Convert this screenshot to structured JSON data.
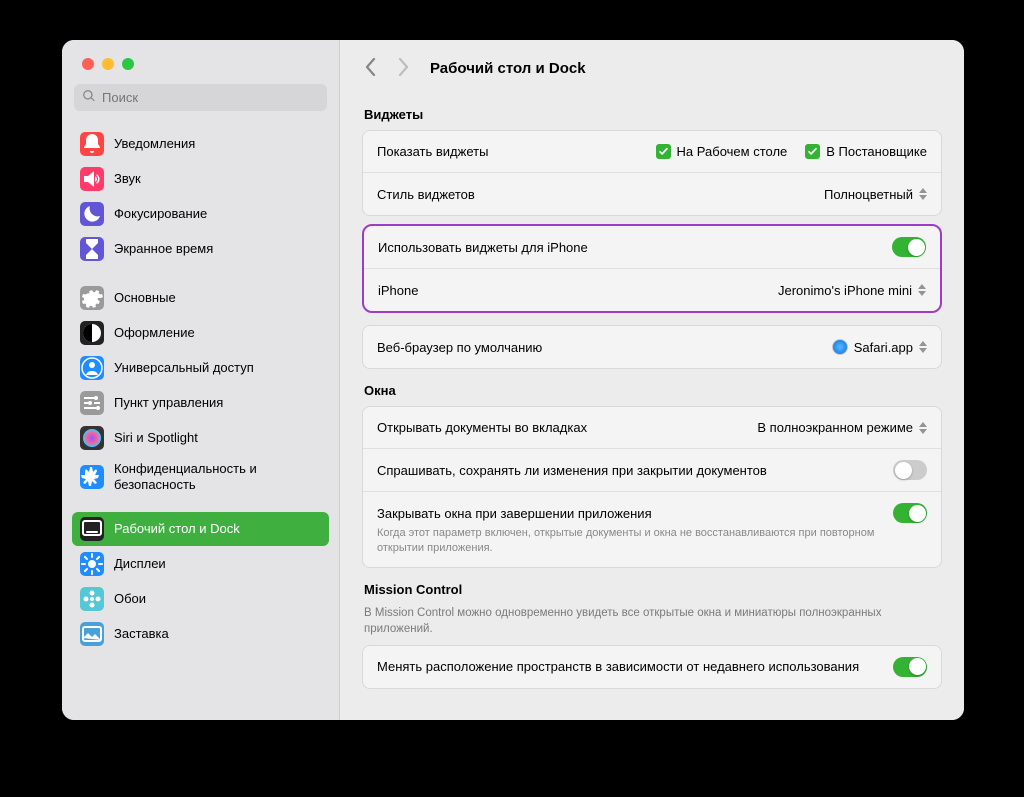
{
  "search": {
    "placeholder": "Поиск"
  },
  "header": {
    "title": "Рабочий стол и Dock"
  },
  "sidebar": {
    "items": [
      {
        "label": "Уведомления",
        "color": "#ff4444",
        "glyph": "bell"
      },
      {
        "label": "Звук",
        "color": "#ff3b6a",
        "glyph": "sound"
      },
      {
        "label": "Фокусирование",
        "color": "#6255d6",
        "glyph": "moon"
      },
      {
        "label": "Экранное время",
        "color": "#6255d6",
        "glyph": "hourglass"
      },
      {
        "label": "Основные",
        "color": "#9a9a9a",
        "glyph": "gear"
      },
      {
        "label": "Оформление",
        "color": "#222",
        "glyph": "halfcircle"
      },
      {
        "label": "Универсальный доступ",
        "color": "#1f8cff",
        "glyph": "person"
      },
      {
        "label": "Пункт управления",
        "color": "#9a9a9a",
        "glyph": "sliders"
      },
      {
        "label": "Siri и Spotlight",
        "color": "#333",
        "glyph": "siri"
      },
      {
        "label": "Конфиденциальность и безопасность",
        "color": "#1f8cff",
        "glyph": "hand"
      },
      {
        "label": "Рабочий стол и Dock",
        "color": "#222",
        "glyph": "dock"
      },
      {
        "label": "Дисплеи",
        "color": "#1f8cff",
        "glyph": "sun"
      },
      {
        "label": "Обои",
        "color": "#55c7d6",
        "glyph": "flower"
      },
      {
        "label": "Заставка",
        "color": "#4aa0d8",
        "glyph": "photo"
      }
    ]
  },
  "widgets": {
    "section_title": "Виджеты",
    "show_label": "Показать виджеты",
    "cb_desktop": "На Рабочем столе",
    "cb_stage": "В Постановщике",
    "style_label": "Стиль виджетов",
    "style_value": "Полноцветный",
    "iphone_use_label": "Использовать виджеты для iPhone",
    "iphone_label": "iPhone",
    "iphone_value": "Jeronimo's iPhone mini"
  },
  "browser": {
    "label": "Веб-браузер по умолчанию",
    "value": "Safari.app"
  },
  "windows": {
    "section_title": "Окна",
    "tabs_label": "Открывать документы во вкладках",
    "tabs_value": "В полноэкранном режиме",
    "ask_label": "Спрашивать, сохранять ли изменения при закрытии документов",
    "close_label": "Закрывать окна при завершении приложения",
    "close_desc": "Когда этот параметр включен, открытые документы и окна не восстанавливаются при повторном открытии приложения."
  },
  "mission": {
    "section_title": "Mission Control",
    "section_desc": "В Mission Control можно одновременно увидеть все открытые окна и миниатюры полноэкранных приложений.",
    "rearrange_label": "Менять расположение пространств в зависимости от недавнего использования"
  }
}
